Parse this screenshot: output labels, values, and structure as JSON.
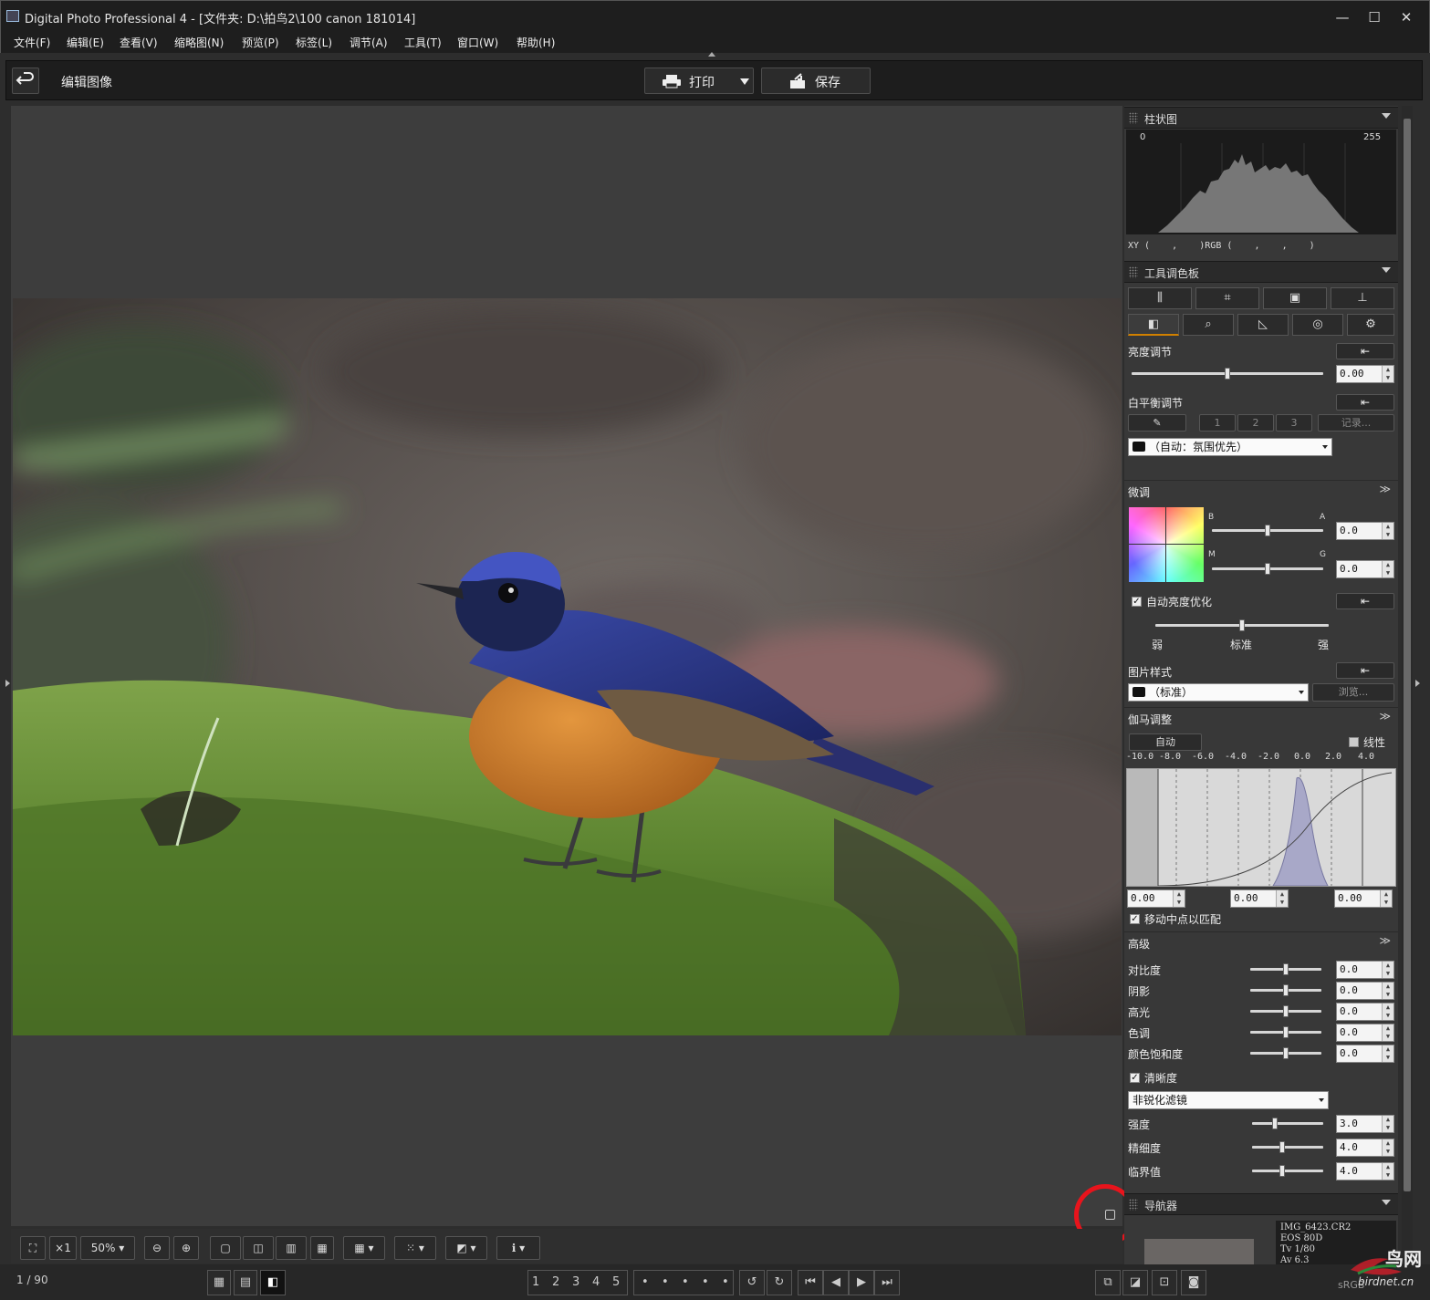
{
  "window": {
    "title": "Digital Photo Professional 4 - [文件夹: D:\\拍鸟2\\100 canon 181014]",
    "minimize": "—",
    "maximize": "☐",
    "close": "✕"
  },
  "menu": [
    "文件(F)",
    "编辑(E)",
    "查看(V)",
    "缩略图(N)",
    "预览(P)",
    "标签(L)",
    "调节(A)",
    "工具(T)",
    "窗口(W)",
    "帮助(H)"
  ],
  "toolbar": {
    "back_icon": "undo-arrow-icon",
    "mode_title": "编辑图像",
    "print_label": "打印",
    "save_label": "保存"
  },
  "histogram": {
    "title": "柱状图",
    "min_label": "0",
    "max_label": "255",
    "readout": "XY (    ,    )RGB (    ,    ,    )"
  },
  "tool_palette": {
    "title": "工具调色板",
    "brightness": {
      "label": "亮度调节",
      "value": "0.00",
      "level": 0.5
    },
    "white_balance": {
      "label": "白平衡调节",
      "slots": [
        "1",
        "2",
        "3"
      ],
      "record": "记录...",
      "preset": "（自动：氛围优先）"
    },
    "fine_tune": {
      "label": "微调",
      "b": "B",
      "a": "A",
      "m": "M",
      "g": "G",
      "ba_value": "0.0",
      "mg_value": "0.0"
    },
    "alo": {
      "label": "自动亮度优化",
      "checked": true,
      "low": "弱",
      "std": "标准",
      "high": "强",
      "level": 0.5
    },
    "picture_style": {
      "label": "图片样式",
      "value": "（标准）",
      "browse": "浏览..."
    },
    "gamma": {
      "label": "伽马调整",
      "auto": "自动",
      "linear": "线性",
      "ticks": [
        "-10.0",
        "-8.0",
        "-6.0",
        "-4.0",
        "-2.0",
        "0.0",
        "2.0",
        "4.0"
      ],
      "v1": "0.00",
      "v2": "0.00",
      "v3": "0.00",
      "match": "移动中点以匹配"
    },
    "advanced": {
      "label": "高级",
      "rows": [
        {
          "label": "对比度",
          "value": "0.0"
        },
        {
          "label": "阴影",
          "value": "0.0"
        },
        {
          "label": "高光",
          "value": "0.0"
        },
        {
          "label": "色调",
          "value": "0.0"
        },
        {
          "label": "颜色饱和度",
          "value": "0.0"
        }
      ],
      "sharp_label": "清晰度",
      "sharp_mode": "非锐化滤镜",
      "sharp_rows": [
        {
          "label": "强度",
          "value": "3.0"
        },
        {
          "label": "精细度",
          "value": "4.0"
        },
        {
          "label": "临界值",
          "value": "4.0"
        }
      ]
    }
  },
  "navigator": {
    "title": "导航器",
    "info": [
      "IMG_6423.CR2",
      "EOS 80D",
      "Tv 1/80",
      "Av 6.3"
    ],
    "colorspace": "sRGB"
  },
  "bottom": {
    "zoom": "50%",
    "x1": "×1",
    "counter": "1 / 90",
    "ratings": [
      "1",
      "2",
      "3",
      "4",
      "5"
    ],
    "checks": [
      "•",
      "•",
      "•",
      "•",
      "•"
    ]
  },
  "watermark": {
    "text": "鸟网",
    "url": "birdnet.cn"
  },
  "colors": {
    "highlight_ring": "#e8141c",
    "bird_blue": "#2d3a8a",
    "bird_orange": "#c9782a"
  }
}
